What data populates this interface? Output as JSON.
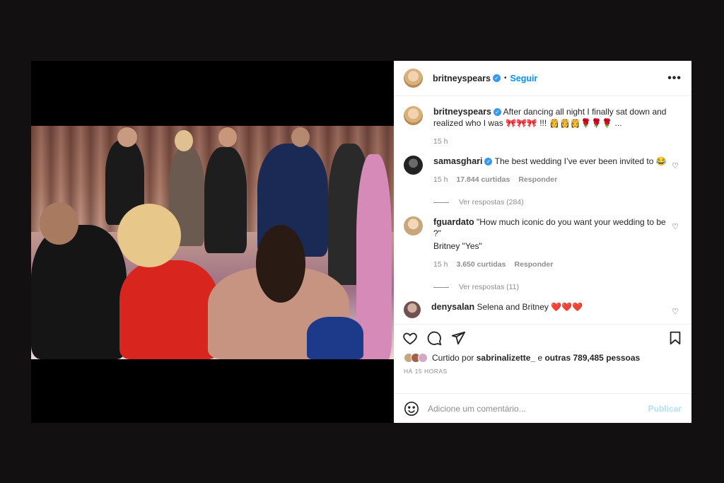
{
  "post": {
    "author": "britneyspears",
    "follow_label": "Seguir",
    "more_label": "•••"
  },
  "caption": {
    "author": "britneyspears",
    "text": "After dancing all night I finally sat down and realized who I was 🎀🎀🎀 !!! 👸👸👸🌹🌹🌹 ...",
    "time": "15 h"
  },
  "comments": [
    {
      "author": "samasghari",
      "text": "The best wedding I’ve ever been invited to 😂",
      "time": "15 h",
      "likes": "17.844 curtidas",
      "reply_label": "Responder",
      "view_replies": "Ver respostas (284)"
    },
    {
      "author": "fguardato",
      "text": "\"How much iconic do you want your wedding to be ?\"",
      "text2": "Britney \"Yes\"",
      "time": "15 h",
      "likes": "3.650 curtidas",
      "reply_label": "Responder",
      "view_replies": "Ver respostas (11)"
    },
    {
      "author": "denysalan",
      "text": "Selena and Britney",
      "hearts": "❤️❤️❤️"
    }
  ],
  "likes": {
    "prefix": "Curtido por",
    "user": "sabrinalizette_",
    "middle": "e",
    "others": "outras 789,485 pessoas"
  },
  "timestamp": "HÁ 15 HORAS",
  "add_comment": {
    "placeholder": "Adicione um comentário...",
    "publish_label": "Publicar"
  },
  "colors": {
    "link": "#0095f6",
    "verified": "#3897f0",
    "publish_disabled": "#b2dffc"
  },
  "icons": [
    "verified-icon",
    "heart-icon",
    "comment-icon",
    "share-icon",
    "bookmark-icon",
    "emoji-icon",
    "more-icon"
  ]
}
